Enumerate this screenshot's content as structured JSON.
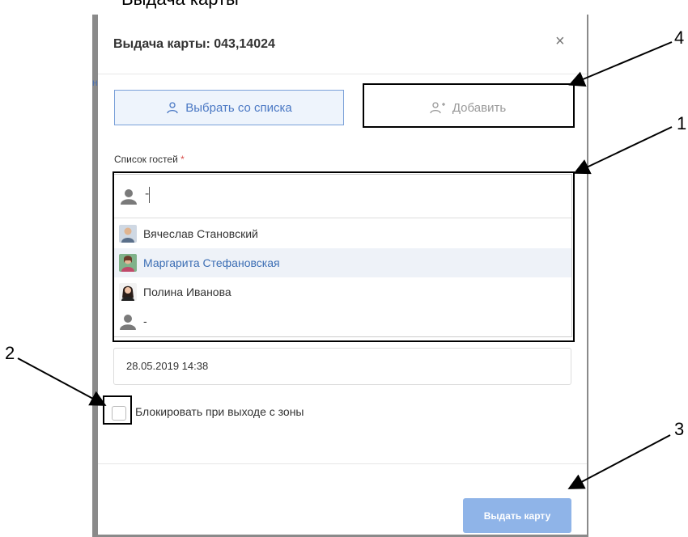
{
  "page_top_text": "Выдача карты",
  "background_fragment": "н",
  "modal": {
    "title": "Выдача карты: 043,14024",
    "close_glyph": "×"
  },
  "tabs": [
    {
      "label": "Выбрать со списка",
      "active": true,
      "icon": "user-icon"
    },
    {
      "label": "Добавить",
      "active": false,
      "icon": "user-add-icon"
    }
  ],
  "guest_field": {
    "label": "Список гостей",
    "required_mark": "*",
    "search_value": "-",
    "options": [
      {
        "name": "Вячеслав Становский",
        "avatar": "photo",
        "highlighted": false
      },
      {
        "name": "Маргарита Стефановская",
        "avatar": "photo",
        "highlighted": true
      },
      {
        "name": "Полина Иванова",
        "avatar": "photo",
        "highlighted": false
      },
      {
        "name": "-",
        "avatar": "placeholder",
        "highlighted": false
      }
    ]
  },
  "date_value": "28.05.2019 14:38",
  "block_checkbox": {
    "label": "Блокировать при выходе с зоны",
    "checked": false
  },
  "issue_button_label": "Выдать карту",
  "callouts": [
    "1",
    "2",
    "3",
    "4"
  ],
  "colors": {
    "accent": "#4a78c4",
    "button_bg": "#8fb4e8",
    "required": "#d9534f",
    "backdrop": "#8a8a8a"
  }
}
